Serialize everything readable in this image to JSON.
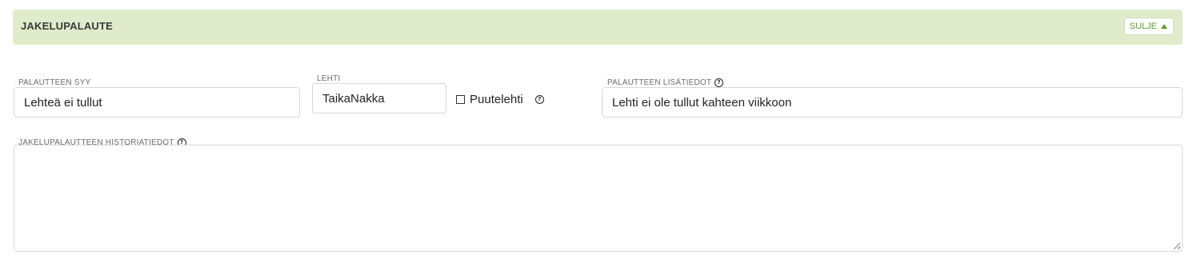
{
  "section": {
    "title": "JAKELUPALAUTE",
    "close_label": "SULJE"
  },
  "fields": {
    "reason": {
      "label": "PALAUTTEEN SYY",
      "value": "Lehteä ei tullut"
    },
    "paper": {
      "label": "LEHTI",
      "value": "TaikaNakka"
    },
    "partial_paper": {
      "label": "Puutelehti",
      "checked": false
    },
    "additional_info": {
      "label": "PALAUTTEEN LISÄTIEDOT",
      "value": "Lehti ei ole tullut kahteen viikkoon"
    },
    "history": {
      "label": "JAKELUPALAUTTEEN HISTORIATIEDOT",
      "value": ""
    }
  },
  "icons": {
    "help": "?",
    "close_caret": "caret-up-icon"
  },
  "colors": {
    "header_bg": "#e0ebcb",
    "accent": "#5f9b2c"
  }
}
